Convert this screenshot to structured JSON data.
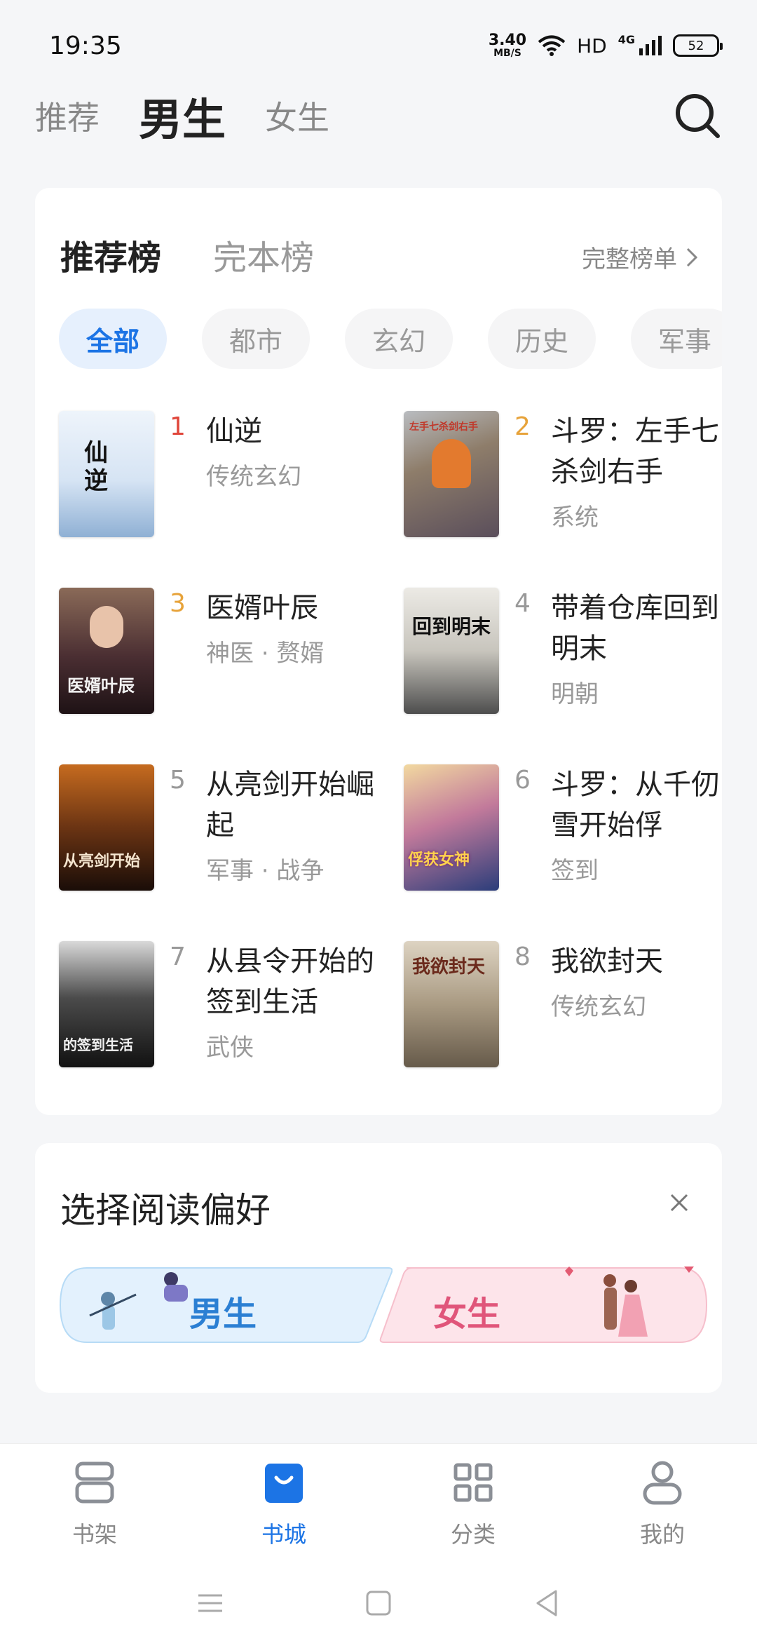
{
  "status": {
    "time": "19:35",
    "net_speed_value": "3.40",
    "net_speed_unit": "MB/S",
    "hd": "HD",
    "network": "4G",
    "battery": "52"
  },
  "top_tabs": [
    "推荐",
    "男生",
    "女生"
  ],
  "top_tab_active": "男生",
  "rank": {
    "tabs": [
      "推荐榜",
      "完本榜"
    ],
    "full_list": "完整榜单",
    "categories": [
      "全部",
      "都市",
      "玄幻",
      "历史",
      "军事"
    ],
    "books": [
      {
        "rank": "1",
        "title": "仙逆",
        "tag": "传统玄幻",
        "cover_text": "仙逆"
      },
      {
        "rank": "2",
        "title": "斗罗：左手七杀剑右手",
        "tag": "系统",
        "cover_text": "左手七杀剑右手"
      },
      {
        "rank": "3",
        "title": "医婿叶辰",
        "tag": "神医 · 赘婿",
        "cover_text": "医婿叶辰"
      },
      {
        "rank": "4",
        "title": "带着仓库回到明末",
        "tag": "明朝",
        "cover_text": "回到明末"
      },
      {
        "rank": "5",
        "title": "从亮剑开始崛起",
        "tag": "军事 · 战争",
        "cover_text": "从亮剑开始"
      },
      {
        "rank": "6",
        "title": "斗罗：从千仞雪开始俘",
        "tag": "签到",
        "cover_text": "俘获女神"
      },
      {
        "rank": "7",
        "title": "从县令开始的签到生活",
        "tag": "武侠",
        "cover_text": "的签到生活"
      },
      {
        "rank": "8",
        "title": "我欲封天",
        "tag": "传统玄幻",
        "cover_text": "我欲封天"
      }
    ]
  },
  "preference": {
    "title": "选择阅读偏好",
    "male": "男生",
    "female": "女生"
  },
  "bottom_nav": [
    "书架",
    "书城",
    "分类",
    "我的"
  ],
  "colors": {
    "accent": "#1c74e5",
    "rank_top1": "#e0453a",
    "rank_top23": "#e7a33a",
    "rank_other": "#999999"
  }
}
